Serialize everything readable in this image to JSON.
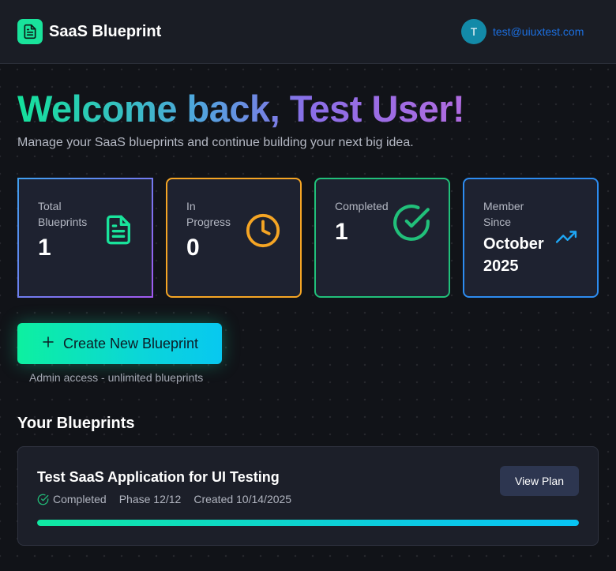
{
  "header": {
    "app_title": "SaaS Blueprint",
    "logo_icon": "document-icon",
    "avatar_initial": "T",
    "user_email": "test@uiuxtest.com"
  },
  "welcome": {
    "title": "Welcome back, Test User!",
    "subtitle": "Manage your SaaS blueprints and continue building your next big idea."
  },
  "stats": [
    {
      "label": "Total Blueprints",
      "value": "1",
      "icon": "document-icon",
      "color": "#a259f0"
    },
    {
      "label": "In Progress",
      "value": "0",
      "icon": "clock-icon",
      "color": "#f5a524"
    },
    {
      "label": "Completed",
      "value": "1",
      "icon": "check-circle-icon",
      "color": "#21c07a"
    },
    {
      "label": "Member Since",
      "value": "October 2025",
      "icon": "trending-up-icon",
      "color": "#2d8cf0"
    }
  ],
  "actions": {
    "create_label": "Create New Blueprint",
    "admin_note": "Admin access - unlimited blueprints"
  },
  "blueprints_section": {
    "title": "Your Blueprints",
    "items": [
      {
        "title": "Test SaaS Application for UI Testing",
        "status": "Completed",
        "phase": "Phase 12/12",
        "created": "Created 10/14/2025",
        "view_label": "View Plan",
        "progress": 1.0
      }
    ]
  },
  "colors": {
    "accent_green": "#19e39b",
    "accent_cyan": "#08c8f0",
    "email_blue": "#1c6fe0"
  }
}
